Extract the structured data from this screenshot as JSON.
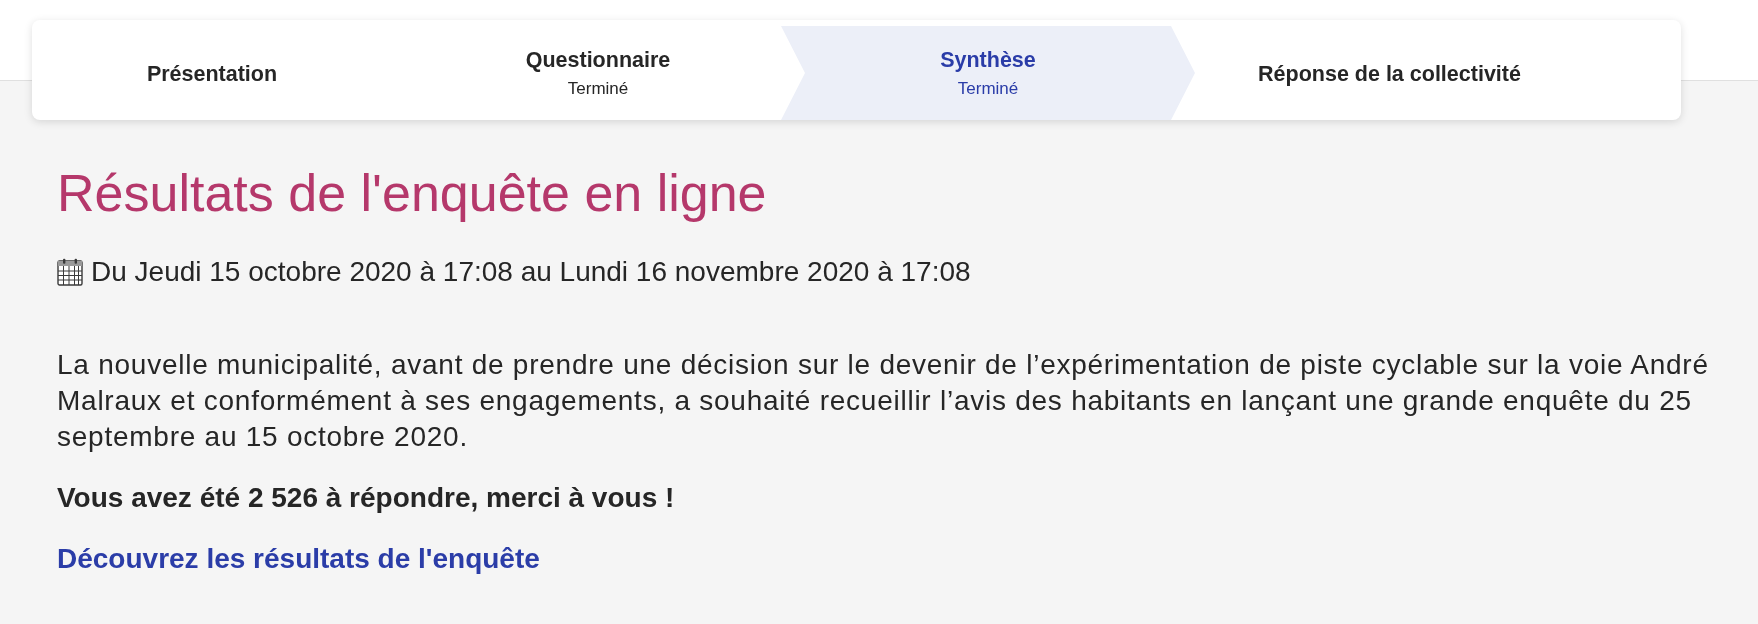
{
  "stepper": {
    "steps": [
      {
        "label": "Présentation",
        "selected": false
      },
      {
        "label": "Questionnaire",
        "status": "Terminé",
        "selected": false
      },
      {
        "label": "Synthèse",
        "status": "Terminé",
        "selected": true
      },
      {
        "label": "Réponse de la collectivité",
        "selected": false
      }
    ]
  },
  "survey": {
    "title": "Résultats de l'enquête en ligne",
    "period": "Du Jeudi 15 octobre 2020 à 17:08 au Lundi 16 novembre 2020 à 17:08",
    "intro": "La nouvelle municipalité, avant de prendre une décision sur le devenir de l’expérimentation de piste cyclable sur la voie André Malraux et conformément à ses engagements, a souhaité recueillir l’avis des habitants en lançant une grande enquête du 25 septembre au 15 octobre 2020.",
    "respondents": "Vous avez été 2 526 à répondre, merci à vous !",
    "results_link": "Découvrez les résultats de l'enquête"
  }
}
